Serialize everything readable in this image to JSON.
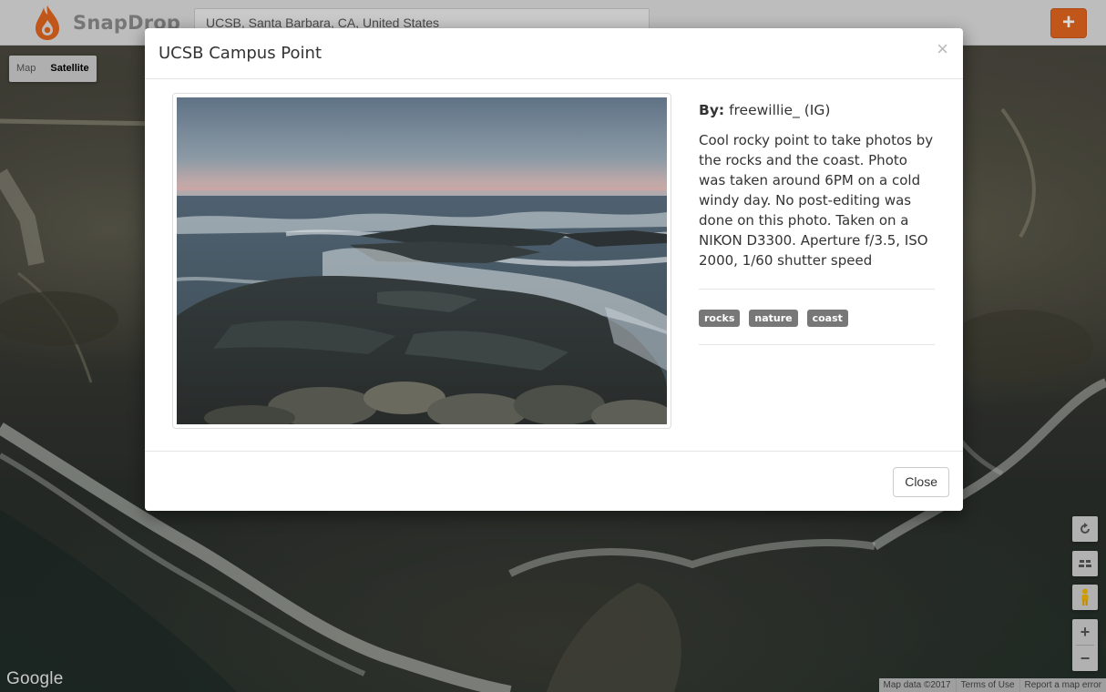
{
  "app": {
    "brand_name": "SnapDrop",
    "logo_icon": "flame-drop-icon",
    "accent_color": "#e0651f"
  },
  "search": {
    "value": "UCSB, Santa Barbara, CA, United States"
  },
  "toolbar": {
    "add_label": "+"
  },
  "map": {
    "type_options": [
      "Map",
      "Satellite"
    ],
    "selected_type": "Satellite",
    "controls": {
      "rotate_icon": "rotate-icon",
      "tilt_icon": "tilt-icon",
      "pegman_icon": "pegman-icon",
      "zoom_in_label": "+",
      "zoom_out_label": "−"
    },
    "logo": "Google",
    "attribution": {
      "map_data": "Map data ©2017",
      "terms": "Terms of Use",
      "report": "Report a map error"
    }
  },
  "modal": {
    "title": "UCSB Campus Point",
    "close_symbol": "×",
    "author_label": "By:",
    "author_value": "freewillie_ (IG)",
    "description": "Cool rocky point to take photos by the rocks and the coast. Photo was taken around 6PM on a cold windy day. No post-editing was done on this photo. Taken on a NIKON D3300. Aperture f/3.5, ISO 2000, 1/60 shutter speed",
    "tags": [
      "rocks",
      "nature",
      "coast"
    ],
    "close_button_label": "Close"
  }
}
